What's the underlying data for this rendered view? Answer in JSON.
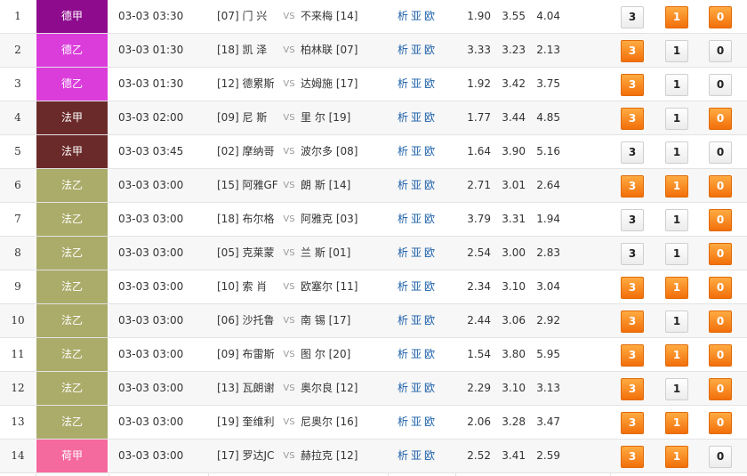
{
  "colors": {
    "德甲": "#8e0b8e",
    "德乙": "#db3ddb",
    "法甲": "#6b2a2a",
    "法乙": "#abab6a",
    "荷甲": "#f4699e",
    "selected": "#f4830f"
  },
  "analysis_labels": [
    "析",
    "亚",
    "欧"
  ],
  "vs_label": "VS",
  "buttons": [
    "3",
    "1",
    "0"
  ],
  "matches": [
    {
      "num": "1",
      "league": "德甲",
      "time": "03-03 03:30",
      "home": "[07] 门 兴",
      "away": "不来梅 [14]",
      "odds": [
        "1.90",
        "3.55",
        "4.04"
      ],
      "selected": [
        false,
        true,
        true
      ]
    },
    {
      "num": "2",
      "league": "德乙",
      "time": "03-03 01:30",
      "home": "[18] 凯 泽",
      "away": "柏林联 [07]",
      "odds": [
        "3.33",
        "3.23",
        "2.13"
      ],
      "selected": [
        true,
        false,
        false
      ]
    },
    {
      "num": "3",
      "league": "德乙",
      "time": "03-03 01:30",
      "home": "[12] 德累斯",
      "away": "达姆施 [17]",
      "odds": [
        "1.92",
        "3.42",
        "3.75"
      ],
      "selected": [
        true,
        false,
        false
      ]
    },
    {
      "num": "4",
      "league": "法甲",
      "time": "03-03 02:00",
      "home": "[09] 尼 斯",
      "away": "里 尔 [19]",
      "odds": [
        "1.77",
        "3.44",
        "4.85"
      ],
      "selected": [
        true,
        false,
        true
      ]
    },
    {
      "num": "5",
      "league": "法甲",
      "time": "03-03 03:45",
      "home": "[02] 摩纳哥",
      "away": "波尔多 [08]",
      "odds": [
        "1.64",
        "3.90",
        "5.16"
      ],
      "selected": [
        false,
        false,
        false
      ]
    },
    {
      "num": "6",
      "league": "法乙",
      "time": "03-03 03:00",
      "home": "[15] 阿雅GF",
      "away": "朗 斯 [14]",
      "odds": [
        "2.71",
        "3.01",
        "2.64"
      ],
      "selected": [
        true,
        true,
        true
      ]
    },
    {
      "num": "7",
      "league": "法乙",
      "time": "03-03 03:00",
      "home": "[18] 布尔格",
      "away": "阿雅克 [03]",
      "odds": [
        "3.79",
        "3.31",
        "1.94"
      ],
      "selected": [
        false,
        false,
        true
      ]
    },
    {
      "num": "8",
      "league": "法乙",
      "time": "03-03 03:00",
      "home": "[05] 克莱蒙",
      "away": "兰 斯 [01]",
      "odds": [
        "2.54",
        "3.00",
        "2.83"
      ],
      "selected": [
        false,
        false,
        true
      ]
    },
    {
      "num": "9",
      "league": "法乙",
      "time": "03-03 03:00",
      "home": "[10] 索 肖",
      "away": "欧塞尔 [11]",
      "odds": [
        "2.34",
        "3.10",
        "3.04"
      ],
      "selected": [
        true,
        true,
        true
      ]
    },
    {
      "num": "10",
      "league": "法乙",
      "time": "03-03 03:00",
      "home": "[06] 沙托鲁",
      "away": "南 锡 [17]",
      "odds": [
        "2.44",
        "3.06",
        "2.92"
      ],
      "selected": [
        true,
        false,
        true
      ]
    },
    {
      "num": "11",
      "league": "法乙",
      "time": "03-03 03:00",
      "home": "[09] 布雷斯",
      "away": "图 尔 [20]",
      "odds": [
        "1.54",
        "3.80",
        "5.95"
      ],
      "selected": [
        true,
        true,
        true
      ]
    },
    {
      "num": "12",
      "league": "法乙",
      "time": "03-03 03:00",
      "home": "[13] 瓦朗谢",
      "away": "奥尔良 [12]",
      "odds": [
        "2.29",
        "3.10",
        "3.13"
      ],
      "selected": [
        true,
        false,
        true
      ]
    },
    {
      "num": "13",
      "league": "法乙",
      "time": "03-03 03:00",
      "home": "[19] 奎维利",
      "away": "尼奥尔 [16]",
      "odds": [
        "2.06",
        "3.28",
        "3.47"
      ],
      "selected": [
        true,
        true,
        true
      ]
    },
    {
      "num": "14",
      "league": "荷甲",
      "time": "03-03 03:00",
      "home": "[17] 罗达JC",
      "away": "赫拉克 [12]",
      "odds": [
        "2.52",
        "3.41",
        "2.59"
      ],
      "selected": [
        true,
        true,
        false
      ]
    }
  ]
}
